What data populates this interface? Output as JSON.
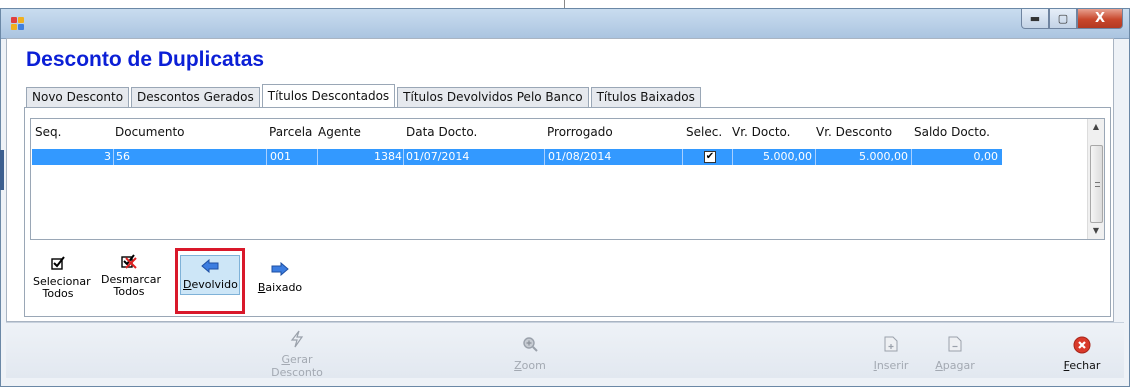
{
  "window": {
    "title": "",
    "controls": {
      "minimize": "▬",
      "maximize": "▢",
      "close": "X"
    }
  },
  "page_title": "Desconto de Duplicatas",
  "tabs": [
    {
      "label": "Novo Desconto",
      "active": false
    },
    {
      "label": "Descontos Gerados",
      "active": false
    },
    {
      "label": "Títulos Descontados",
      "active": true
    },
    {
      "label": "Títulos Devolvidos Pelo Banco",
      "active": false
    },
    {
      "label": "Títulos Baixados",
      "active": false
    }
  ],
  "grid": {
    "columns": [
      "Seq.",
      "Documento",
      "Parcela",
      "Agente",
      "Data Docto.",
      "Prorrogado",
      "Selec.",
      "Vr. Docto.",
      "Vr. Desconto",
      "Saldo Docto."
    ],
    "rows": [
      {
        "seq": "3",
        "documento": "56",
        "parcela": "001",
        "agente": "1384",
        "data_docto": "01/07/2014",
        "prorrogado": "01/08/2014",
        "selec": "✔",
        "vr_docto": "5.000,00",
        "vr_desconto": "5.000,00",
        "saldo_docto": "0,00"
      }
    ],
    "selected_row_color": "#3399ff"
  },
  "actions": {
    "select_all": {
      "line1": "Selecionar",
      "line2": "Todos",
      "icon": "check-icon"
    },
    "deselect_all": {
      "line1": "Desmarcar",
      "line2": "Todos",
      "icon": "uncheck-icon"
    },
    "returned": {
      "label_u": "D",
      "label_rest": "evolvido",
      "icon": "arrow-left-icon"
    },
    "settled": {
      "label_u": "B",
      "label_rest": "aixado",
      "icon": "arrow-right-icon"
    }
  },
  "toolbar": {
    "gerar": {
      "line1_u": "G",
      "line1_rest": "erar",
      "line2": "Desconto",
      "enabled": false
    },
    "zoom": {
      "label_u": "Z",
      "label_rest": "oom",
      "enabled": false
    },
    "inserir": {
      "label_u": "I",
      "label_rest": "nserir",
      "enabled": false
    },
    "apagar": {
      "label_u": "A",
      "label_rest": "pagar",
      "enabled": false
    },
    "fechar": {
      "label_u": "F",
      "label_rest": "echar",
      "enabled": true
    }
  },
  "colors": {
    "title_blue": "#0b1fd6",
    "highlight_border": "#d9182a",
    "close_red": "#c8472c"
  }
}
